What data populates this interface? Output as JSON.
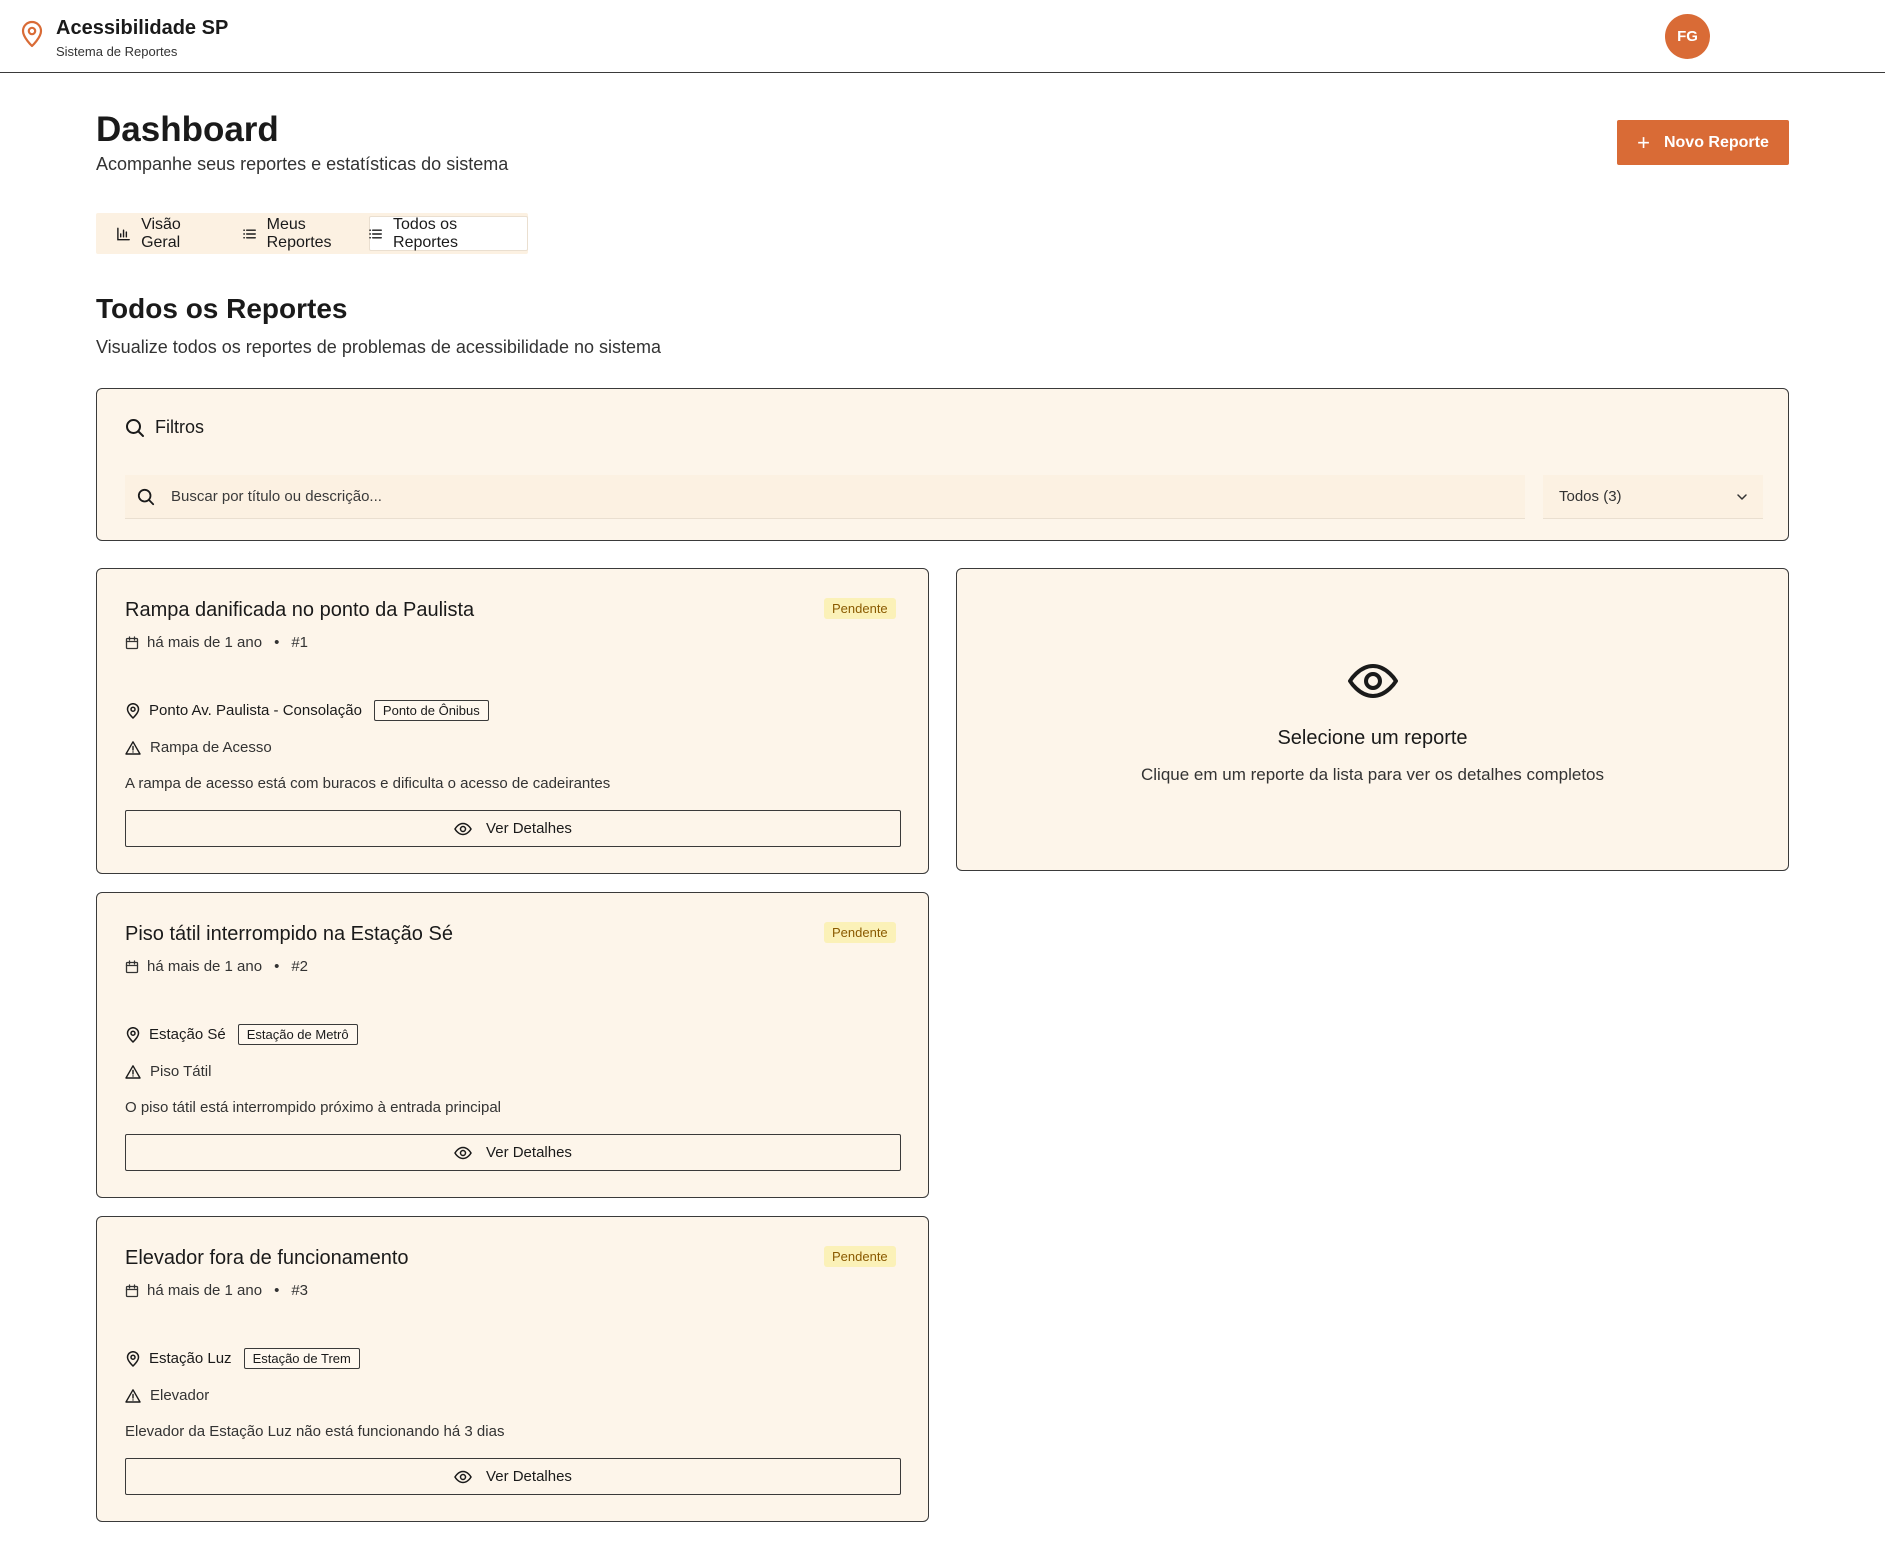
{
  "header": {
    "app_title": "Acessibilidade SP",
    "app_subtitle": "Sistema de Reportes",
    "avatar_initials": "FG"
  },
  "page": {
    "title": "Dashboard",
    "subtitle": "Acompanhe seus reportes e estatísticas do sistema",
    "new_report_label": "Novo Reporte"
  },
  "tabs": [
    {
      "label": "Visão Geral",
      "icon": "bar-chart-icon",
      "active": false
    },
    {
      "label": "Meus Reportes",
      "icon": "list-icon",
      "active": false
    },
    {
      "label": "Todos os Reportes",
      "icon": "list-icon",
      "active": true
    }
  ],
  "section": {
    "title": "Todos os Reportes",
    "subtitle": "Visualize todos os reportes de problemas de acessibilidade no sistema"
  },
  "filters": {
    "title": "Filtros",
    "search_placeholder": "Buscar por título ou descrição...",
    "status_selected": "Todos (3)"
  },
  "reports": [
    {
      "title": "Rampa danificada no ponto da Paulista",
      "status": "Pendente",
      "date": "há mais de 1 ano",
      "id": "#1",
      "location": "Ponto Av. Paulista - Consolação",
      "location_type": "Ponto de Ônibus",
      "category": "Rampa de Acesso",
      "description": "A rampa de acesso está com buracos e dificulta o acesso de cadeirantes",
      "details_label": "Ver Detalhes"
    },
    {
      "title": "Piso tátil interrompido na Estação Sé",
      "status": "Pendente",
      "date": "há mais de 1 ano",
      "id": "#2",
      "location": "Estação Sé",
      "location_type": "Estação de Metrô",
      "category": "Piso Tátil",
      "description": "O piso tátil está interrompido próximo à entrada principal",
      "details_label": "Ver Detalhes"
    },
    {
      "title": "Elevador fora de funcionamento",
      "status": "Pendente",
      "date": "há mais de 1 ano",
      "id": "#3",
      "location": "Estação Luz",
      "location_type": "Estação de Trem",
      "category": "Elevador",
      "description": "Elevador da Estação Luz não está funcionando há 3 dias",
      "details_label": "Ver Detalhes"
    }
  ],
  "detail_panel": {
    "title": "Selecione um reporte",
    "subtitle": "Clique em um reporte da lista para ver os detalhes completos"
  },
  "colors": {
    "accent": "#d96b36",
    "panel_bg": "#fdf5ea",
    "badge_bg": "#fbf1b8"
  }
}
